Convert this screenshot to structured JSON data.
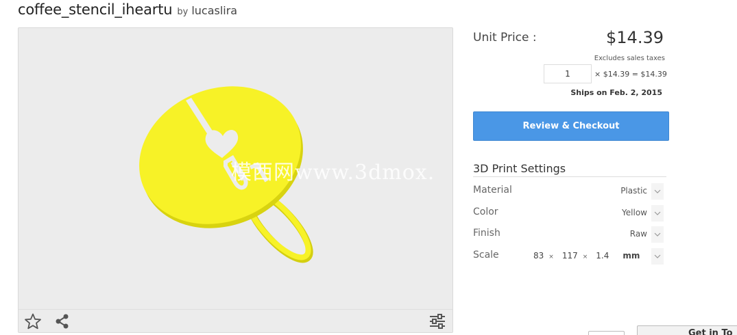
{
  "product": {
    "title": "coffee_stencil_iheartu",
    "by_label": "by",
    "author": "lucaslira"
  },
  "viewer": {
    "watermark": "模西网www.3dmox.",
    "model_color": "#f7f227",
    "toolbar": {
      "left_icons": [
        "star-icon",
        "share-icon"
      ],
      "right_icons": [
        "sliders-icon"
      ]
    }
  },
  "pricing": {
    "unit_price_label": "Unit Price :",
    "unit_price": "$14.39",
    "tax_note": "Excludes sales taxes",
    "quantity": "1",
    "calc": "× $14.39 = $14.39",
    "ships": "Ships on Feb. 2, 2015",
    "checkout_label": "Review & Checkout",
    "checkout_color": "#4a97e6"
  },
  "settings": {
    "title": "3D Print Settings",
    "material": {
      "label": "Material",
      "value": "Plastic"
    },
    "color": {
      "label": "Color",
      "value": "Yellow"
    },
    "finish": {
      "label": "Finish",
      "value": "Raw"
    },
    "scale": {
      "label": "Scale",
      "x": "83",
      "y": "117",
      "z": "1.4",
      "times": "×",
      "unit": "mm"
    }
  },
  "footer": {
    "cart_button_label": "Get in To"
  }
}
